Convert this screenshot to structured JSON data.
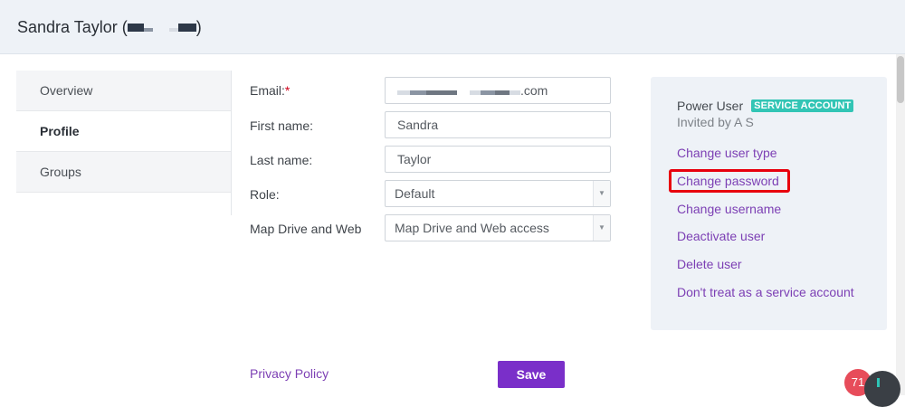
{
  "header": {
    "title_prefix": "Sandra Taylor (",
    "title_suffix": ")"
  },
  "sidenav": {
    "items": [
      {
        "label": "Overview",
        "active": false
      },
      {
        "label": "Profile",
        "active": true
      },
      {
        "label": "Groups",
        "active": false
      }
    ]
  },
  "form": {
    "email": {
      "label": "Email:",
      "required_mark": "*",
      "value_suffix": ".com"
    },
    "first_name": {
      "label": "First name:",
      "value": "Sandra"
    },
    "last_name": {
      "label": "Last name:",
      "value": "Taylor"
    },
    "role": {
      "label": "Role:",
      "value": "Default"
    },
    "map_drive": {
      "label": "Map Drive and Web",
      "value": "Map Drive and Web access"
    }
  },
  "card": {
    "role": "Power User",
    "badge": "SERVICE ACCOUNT",
    "invited": "Invited by A S",
    "actions": [
      "Change user type",
      "Change password",
      "Change username",
      "Deactivate user",
      "Delete user",
      "Don't treat as a service account"
    ]
  },
  "footer": {
    "privacy_link": "Privacy Policy",
    "save_label": "Save"
  },
  "notification": {
    "count": "71"
  },
  "colors": {
    "accent": "#7a2fc9",
    "link": "#7c3fb4",
    "badge": "#32c5b5",
    "highlight": "#e8000d"
  }
}
